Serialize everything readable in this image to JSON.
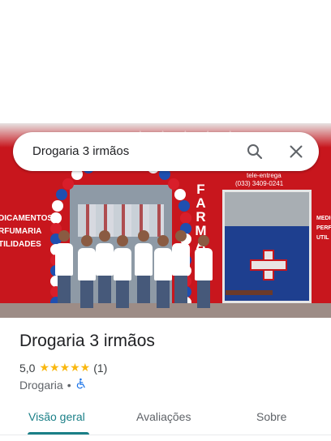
{
  "search": {
    "query": "Drogaria 3 irmãos",
    "search_icon": "search-icon",
    "clear_icon": "close-icon"
  },
  "photo": {
    "store_sign_vertical": "FARMA",
    "left_sign_lines": [
      "DICAMENTOS",
      "RFUMARIA",
      "TILIDADES"
    ],
    "delivery_label": "tele-entrega",
    "delivery_phone": "(033) 3409-0241",
    "right_sign_lines": [
      "MEDIC",
      "PERF",
      "UTIL"
    ]
  },
  "place": {
    "name": "Drogaria 3 irmãos",
    "rating": "5,0",
    "stars": "★★★★★",
    "review_count": "(1)",
    "category": "Drogaria",
    "separator": "•",
    "accessibility_icon": "wheelchair-icon"
  },
  "tabs": [
    {
      "label": "Visão geral",
      "active": true
    },
    {
      "label": "Avaliações",
      "active": false
    },
    {
      "label": "Sobre",
      "active": false
    }
  ],
  "colors": {
    "accent": "#1a7f87",
    "star": "#f9b811",
    "storefront_red": "#c8161d",
    "accessibility_blue": "#1a73e8"
  }
}
